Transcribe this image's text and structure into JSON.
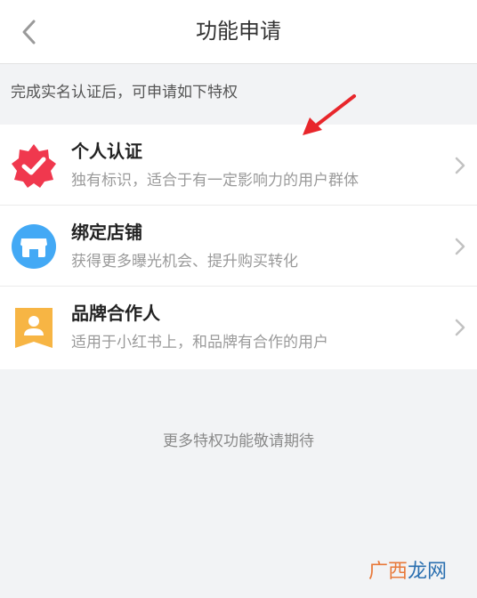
{
  "navbar": {
    "title": "功能申请"
  },
  "hint": "完成实名认证后，可申请如下特权",
  "items": [
    {
      "title": "个人认证",
      "subtitle": "独有标识，适合于有一定影响力的用户群体",
      "icon": "verified-badge-icon",
      "color": "#f0384e"
    },
    {
      "title": "绑定店铺",
      "subtitle": "获得更多曝光机会、提升购买转化",
      "icon": "store-icon",
      "color": "#43a9f5"
    },
    {
      "title": "品牌合作人",
      "subtitle": "适用于小红书上，和品牌有合作的用户",
      "icon": "person-card-icon",
      "color": "#f7b544"
    }
  ],
  "footer": {
    "more": "更多特权功能敬请期待"
  },
  "watermark": {
    "part1": "广西",
    "part2": "龙网"
  }
}
